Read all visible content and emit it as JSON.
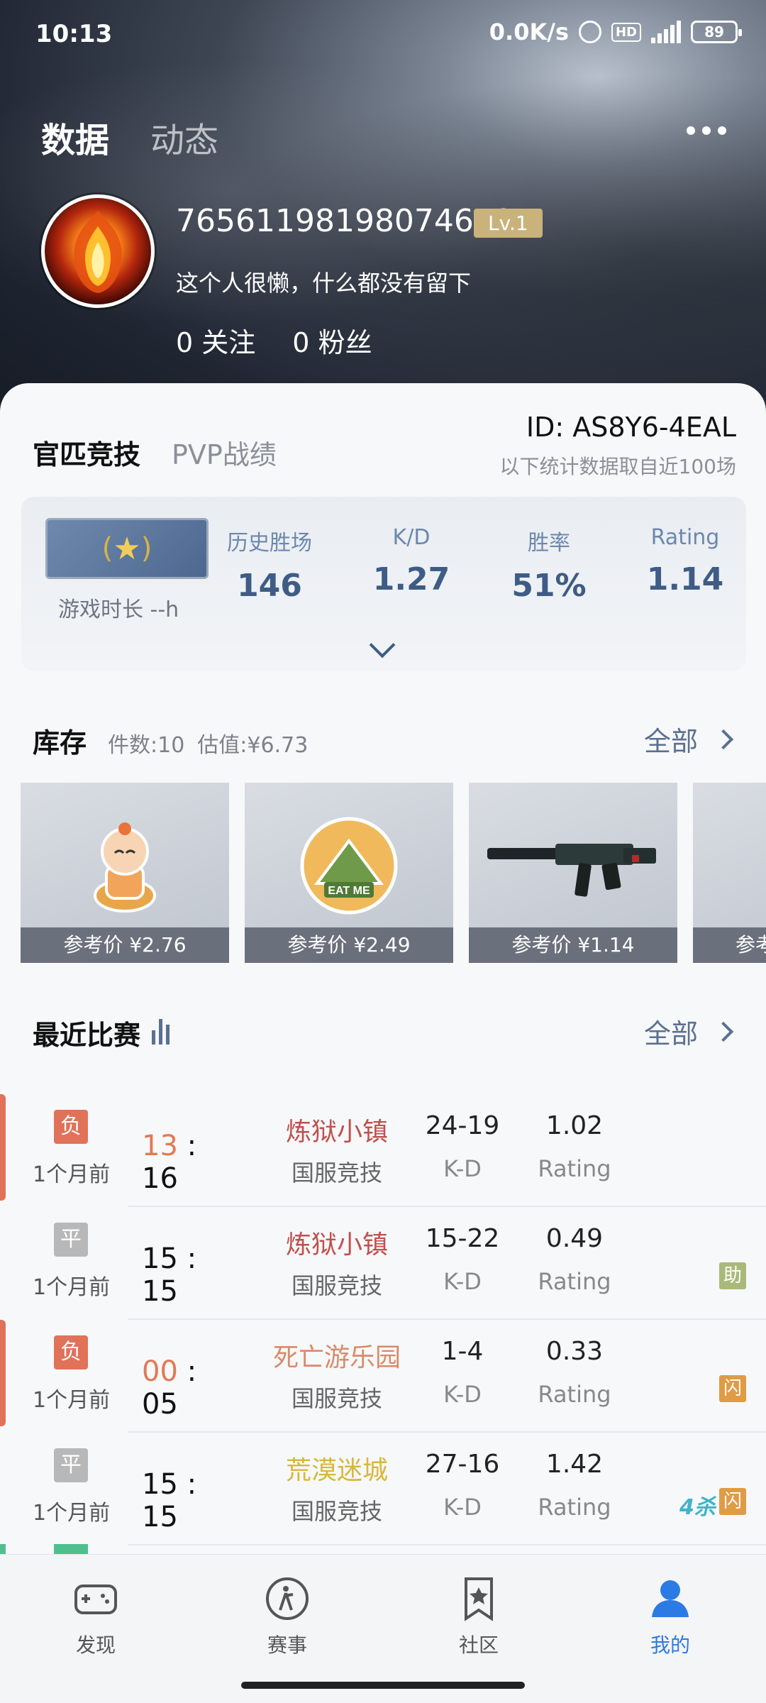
{
  "status_bar": {
    "time": "10:13",
    "net_speed": "0.0K/s",
    "hd": "HD",
    "network": "4G",
    "battery": "89"
  },
  "header": {
    "tabs": [
      {
        "label": "数据"
      },
      {
        "label": "动态"
      }
    ],
    "user_id": "76561198198074650",
    "level": "Lv.1",
    "bio": "这个人很懒，什么都没有留下",
    "following_count": "0",
    "following_label": "关注",
    "followers_count": "0",
    "followers_label": "粉丝"
  },
  "profile": {
    "subtabs": [
      {
        "label": "官匹竞技"
      },
      {
        "label": "PVP战绩"
      }
    ],
    "player_id": "ID: AS8Y6-4EAL",
    "stat_note": "以下统计数据取自近100场",
    "playtime": "游戏时长 --h",
    "stats": [
      {
        "label": "历史胜场",
        "value": "146"
      },
      {
        "label": "K/D",
        "value": "1.27"
      },
      {
        "label": "胜率",
        "value": "51%"
      },
      {
        "label": "Rating",
        "value": "1.14"
      }
    ]
  },
  "inventory": {
    "title": "库存",
    "count": "件数:10",
    "value": "估值:¥6.73",
    "all_label": "全部",
    "items": [
      {
        "price": "参考价 ¥2.76",
        "icon": "monk-sticker-icon"
      },
      {
        "price": "参考价 ¥2.49",
        "icon": "zongzi-sticker-icon"
      },
      {
        "price": "参考价 ¥1.14",
        "icon": "mp5-rifle-icon"
      },
      {
        "price": "参考",
        "icon": "smg-icon"
      }
    ]
  },
  "recent_matches": {
    "title": "最近比赛",
    "all_label": "全部",
    "kd_label": "K-D",
    "rating_label": "Rating",
    "matches": [
      {
        "result": "负",
        "result_color": "#e0725a",
        "time": "1个月前",
        "score_a": "13",
        "score_b": "16",
        "score_a_color": "#e07a55",
        "map": "炼狱小镇",
        "map_color": "#c0504d",
        "mode": "国服竞技",
        "kd": "24-19",
        "rating": "1.02",
        "accent": "#e0725a",
        "tags": []
      },
      {
        "result": "平",
        "result_color": "#b8b8b8",
        "time": "1个月前",
        "score_a": "15",
        "score_b": "15",
        "score_a_color": "#111111",
        "map": "炼狱小镇",
        "map_color": "#c0504d",
        "mode": "国服竞技",
        "kd": "15-22",
        "rating": "0.49",
        "accent": "",
        "tags": [
          {
            "label": "助",
            "color": "#a9b97a"
          }
        ]
      },
      {
        "result": "负",
        "result_color": "#e0725a",
        "time": "1个月前",
        "score_a": "00",
        "score_b": "05",
        "score_a_color": "#e07a55",
        "map": "死亡游乐园",
        "map_color": "#d98a6a",
        "mode": "国服竞技",
        "kd": "1-4",
        "rating": "0.33",
        "accent": "#e0725a",
        "tags": [
          {
            "label": "闪",
            "color": "#e09b45"
          }
        ]
      },
      {
        "result": "平",
        "result_color": "#b8b8b8",
        "time": "1个月前",
        "score_a": "15",
        "score_b": "15",
        "score_a_color": "#111111",
        "map": "荒漠迷城",
        "map_color": "#d7b83a",
        "mode": "国服竞技",
        "kd": "27-16",
        "rating": "1.42",
        "accent": "",
        "tags": [
          {
            "label": "闪",
            "color": "#e09b45"
          }
        ],
        "badge_4k": "4杀"
      }
    ]
  },
  "bottom_nav": [
    {
      "label": "发现",
      "icon": "gamepad-icon"
    },
    {
      "label": "赛事",
      "icon": "soldier-icon"
    },
    {
      "label": "社区",
      "icon": "bookmark-star-icon"
    },
    {
      "label": "我的",
      "icon": "user-icon",
      "active": true
    }
  ]
}
